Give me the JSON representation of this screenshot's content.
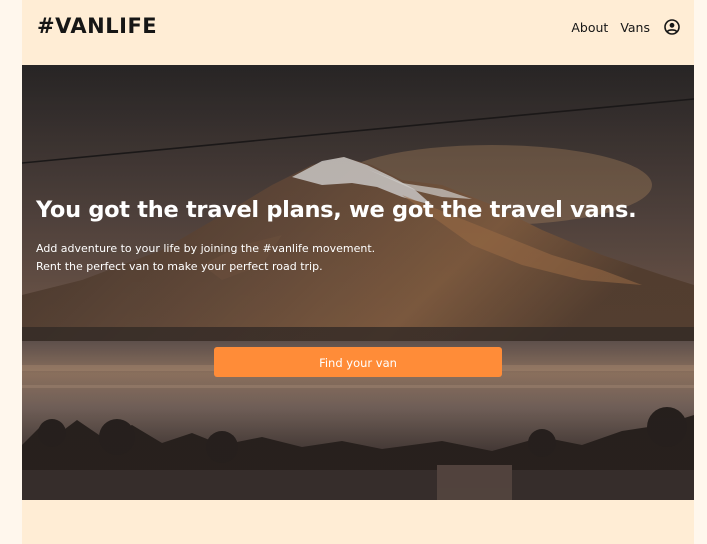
{
  "header": {
    "logo": "#VANLIFE",
    "nav": {
      "about": "About",
      "vans": "Vans",
      "user_icon": "user-circle-icon"
    }
  },
  "hero": {
    "title": "You got the travel plans, we got the travel vans.",
    "subtitle_line1": "Add adventure to your life by joining the #vanlife movement.",
    "subtitle_line2": "Rent the perfect van to make your perfect road trip.",
    "cta_label": "Find your van"
  },
  "colors": {
    "page_background": "#FFEDD5",
    "accent": "#FF8C38",
    "text_dark": "#161616"
  }
}
